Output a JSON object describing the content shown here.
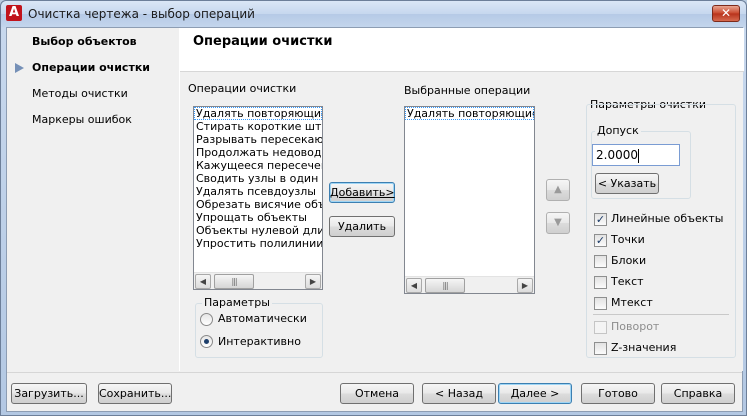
{
  "window": {
    "title": "Очистка чертежа - выбор операций",
    "close_label": "✕",
    "app_icon": "A"
  },
  "sidebar": {
    "items": [
      {
        "label": "Выбор объектов"
      },
      {
        "label": "Операции очистки"
      },
      {
        "label": "Методы очистки"
      },
      {
        "label": "Маркеры ошибок"
      }
    ],
    "active_index": 1
  },
  "main": {
    "title": "Операции очистки",
    "operations_label": "Операции очистки",
    "operations": [
      "Удалять повторяющиеся",
      "Стирать короткие штрих",
      "Разрывать пересекающ",
      "Продолжать недоводы",
      "Кажущееся пересечение",
      "Сводить узлы в один",
      "Удалять псевдоузлы",
      "Обрезать висячие объек",
      "Упрощать объекты",
      "Объекты нулевой длины",
      "Упростить полилинии"
    ],
    "selected_label": "Выбранные операции",
    "selected_operations": [
      "Удалять повторяющиеся"
    ],
    "add_button": "Добавить>",
    "remove_button": "Удалить",
    "params_group": "Параметры",
    "radio_auto": "Автоматически",
    "radio_interactive": "Интерактивно",
    "radio_selected": "interactive",
    "cleanup_params_label": "Параметры очистки",
    "tolerance_group": "Допуск",
    "tolerance_value": "2.0000",
    "pick_button": "< Указать",
    "checkboxes": [
      {
        "label": "Линейные объекты",
        "checked": true,
        "enabled": true
      },
      {
        "label": "Точки",
        "checked": true,
        "enabled": true
      },
      {
        "label": "Блоки",
        "checked": false,
        "enabled": true
      },
      {
        "label": "Текст",
        "checked": false,
        "enabled": true
      },
      {
        "label": "Мтекст",
        "checked": false,
        "enabled": true
      },
      {
        "label": "Поворот",
        "checked": false,
        "enabled": false
      },
      {
        "label": "Z-значения",
        "checked": false,
        "enabled": true
      }
    ],
    "up_icon": "arrow-up-icon",
    "down_icon": "arrow-down-icon"
  },
  "footer": {
    "load": "Загрузить...",
    "save": "Сохранить...",
    "cancel": "Отмена",
    "back": "< Назад",
    "next": "Далее >",
    "finish": "Готово",
    "help": "Справка"
  },
  "colors": {
    "accent_arrow": "#7590b7",
    "title_bar": "#c6d7ee",
    "close_button": "#c8452b",
    "app_icon": "#c1131b"
  }
}
